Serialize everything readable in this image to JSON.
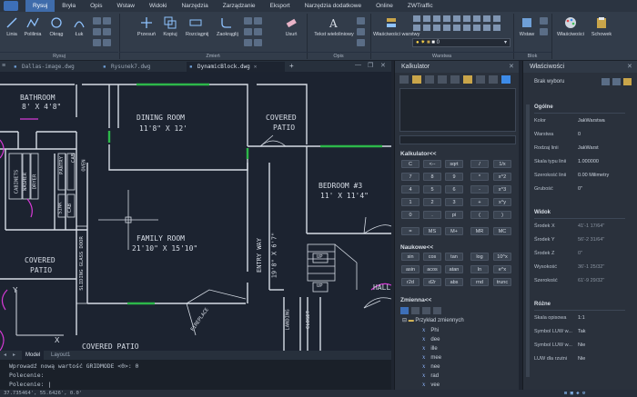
{
  "menubar": {
    "tabs": [
      "Rysuj",
      "Bryła",
      "Opis",
      "Wstaw",
      "Widoki",
      "Narzędzia",
      "Zarządzanie",
      "Eksport",
      "Narzędzia dodatkowe",
      "Online",
      "ZWTraffic"
    ],
    "active": "Rysuj"
  },
  "ribbon": {
    "buttons": [
      "Linia",
      "Polilinia",
      "Okrąg",
      "Łuk",
      "Przesuń",
      "Kopiuj",
      "Rozciągnij",
      "Zaokrąglij",
      "Usuń",
      "Tekst wieloliniowy",
      "Właściwości warstwy",
      "Wstaw",
      "Właściwości",
      "Schowek"
    ],
    "groups": [
      "Rysuj",
      "Zmień",
      "Opis",
      "Warstwa",
      "Blok"
    ],
    "layer_value": "0"
  },
  "doc_tabs": [
    {
      "label": "Dallas-image.dwg",
      "active": false
    },
    {
      "label": "Rysunek7.dwg",
      "active": false
    },
    {
      "label": "DynamicBlock.dwg",
      "active": true
    }
  ],
  "drawing": {
    "rooms": [
      {
        "name": "BATHROOM",
        "dim": "8' X 4'8\""
      },
      {
        "name": "DINING ROOM",
        "dim": "11'8\" X 12'"
      },
      {
        "name": "COVERED",
        "dim": "PATIO"
      },
      {
        "name": "BEDROOM #3",
        "dim": "11' X 11'4\""
      },
      {
        "name": "FAMILY ROOM",
        "dim": "21'10\" X 15'10\""
      },
      {
        "name": "COVERED",
        "dim": "PATIO"
      }
    ],
    "labels": [
      "CABINETS",
      "WASHER",
      "DRYER",
      "PANTRY",
      "CAB",
      "OVEN",
      "SINK",
      "CAB",
      "SLIDING GLASS DOOR",
      "ENTRY WAY",
      "19'8\" X 6'7\"",
      "UP",
      "UP",
      "LANDING",
      "CLOSET",
      "FIREPLACE",
      "HALL",
      "COVERED PATIO"
    ]
  },
  "layout_tabs": [
    "Model",
    "Layout1"
  ],
  "command": {
    "history": [
      "Wprowadź nową wartość GRIDMODE  <0>: 0",
      "Polecenie:"
    ],
    "prompt": "Polecenie:"
  },
  "status": {
    "coords": "37.735464', 55.6426', 0.0'"
  },
  "calculator": {
    "title": "Kalkulator",
    "section_calc": "Kalkulator<<",
    "calc_buttons": [
      "C",
      "<--",
      "sqrt",
      "/",
      "1/x",
      "7",
      "8",
      "9",
      "*",
      "x^2",
      "4",
      "5",
      "6",
      "-",
      "x^3",
      "1",
      "2",
      "3",
      "+",
      "x^y",
      "0",
      ".",
      "pi",
      "(",
      ")",
      "=",
      "MS",
      "M+",
      "MR",
      "MC"
    ],
    "section_sci": "Naukowe<<",
    "sci_buttons": [
      "sin",
      "cos",
      "tan",
      "log",
      "10^x",
      "asin",
      "acos",
      "atan",
      "ln",
      "e^x",
      "r2d",
      "d2r",
      "abs",
      "rnd",
      "trunc"
    ],
    "section_var": "Zmienna<<",
    "var_folder": "Przykład zmiennych",
    "variables": [
      "Phi",
      "dee",
      "ille",
      "mee",
      "nee",
      "rad",
      "vee"
    ]
  },
  "properties": {
    "title": "Właściwości",
    "selection": "Brak wyboru",
    "sections": [
      {
        "name": "Ogólne",
        "rows": [
          {
            "k": "Kolor",
            "v": "JakWarstwa"
          },
          {
            "k": "Warstwa",
            "v": "0"
          },
          {
            "k": "Rodzaj linii",
            "v": "JakWarst"
          },
          {
            "k": "Skala typu linii",
            "v": "1.000000"
          },
          {
            "k": "Szerokość linii",
            "v": "0.00 Milimetry"
          },
          {
            "k": "Grubość",
            "v": "0\""
          }
        ]
      },
      {
        "name": "Widok",
        "rows": [
          {
            "k": "Środek X",
            "v": "41'-1 17/64\""
          },
          {
            "k": "Środek Y",
            "v": "56'-2 31/64\""
          },
          {
            "k": "Środek Z",
            "v": "0\""
          },
          {
            "k": "Wysokość",
            "v": "36'-1 25/32\""
          },
          {
            "k": "Szerokość",
            "v": "61'-9 29/32\""
          }
        ]
      },
      {
        "name": "Różne",
        "rows": [
          {
            "k": "Skala opisowa",
            "v": "1:1"
          },
          {
            "k": "Symbol LUW w...",
            "v": "Tak"
          },
          {
            "k": "Symbol LUW w...",
            "v": "Nie"
          },
          {
            "k": "LUW dla rzutni",
            "v": "Nie"
          }
        ]
      }
    ]
  },
  "colors": {
    "accent": "#3f6cab",
    "canvas": "#1c2330",
    "wall": "#d7dde6",
    "green": "#2db84a",
    "magenta": "#d63ad6"
  }
}
